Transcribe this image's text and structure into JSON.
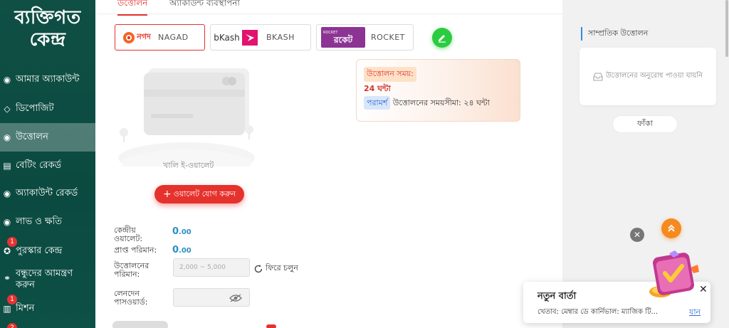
{
  "sidebar": {
    "title_line1": "ব্যক্তিগত",
    "title_line2": "কেন্দ্র",
    "items": [
      {
        "label": "আমার অ্যাকাউন্ট"
      },
      {
        "label": "ডিপোজিট"
      },
      {
        "label": "উত্তোলন"
      },
      {
        "label": "বেটিং রেকর্ড"
      },
      {
        "label": "অ্যাকাউন্ট রেকর্ড"
      },
      {
        "label": "লাভ ও ক্ষতি"
      },
      {
        "label": "পুরস্কার কেন্দ্র",
        "badge": "1"
      },
      {
        "label_line1": "বন্ধুদের আমন্ত্রণ",
        "label_line2": "করুন"
      },
      {
        "label": "মিশন",
        "badge": "1"
      }
    ],
    "next_badge": "2"
  },
  "tabs": [
    {
      "label": "উত্তোলন",
      "active": true
    },
    {
      "label": "অ্যাকাউন্ট ব্যবস্থাপনা",
      "active": false
    }
  ],
  "payment_methods": [
    {
      "logo_text": "নগদ",
      "name": "NAGAD",
      "selected": true
    },
    {
      "logo_text": "bKash",
      "name": "BKASH",
      "selected": false
    },
    {
      "logo_text": "রকেট",
      "logo_small": "ROCKET",
      "name": "ROCKET",
      "selected": false
    }
  ],
  "wallet": {
    "empty_label": "খালি ই-ওয়ালেট",
    "add_button": "ওয়ালেট যোগ করুন"
  },
  "info": {
    "time_tag": "উত্তোলন সময়:",
    "time_value": "24 ঘন্টা",
    "advice_tag": "পরামর্শ",
    "advice_text": "উত্তোলনের সময়সীমা: ২৪ ঘন্টা"
  },
  "form": {
    "central_wallet_label_1": "কেন্দ্রীয়",
    "central_wallet_label_2": "ওয়ালেট:",
    "central_wallet_value": "0",
    "central_wallet_decimals": ".00",
    "received_label": "প্রাপ্ত পরিমান:",
    "received_value": "0",
    "received_decimals": ".00",
    "withdraw_amount_label_1": "উত্তোলনের",
    "withdraw_amount_label_2": "পরিমান:",
    "withdraw_amount_placeholder": "2,000 ~ 5,000",
    "refresh_label": "ফিরে চলুন",
    "password_label_1": "লেনদেন",
    "password_label_2": "পাসওয়ার্ড:"
  },
  "recent": {
    "title": "সাম্প্রতিক উত্তোলন",
    "empty_text": "উত্তোলনের অনুরোধ পাওয়া যায়নি",
    "empty_button": "ফাঁকা"
  },
  "news": {
    "title": "নতুন বার্তা",
    "text": "খেতাব: মেম্বার ডে কার্নিভাল: ম্যাজিক টি...",
    "link": "যান"
  },
  "colors": {
    "accent_red": "#e5322d",
    "sidebar_green": "#0f4f44",
    "value_blue": "#2b8fc6",
    "edit_green": "#2bcc3f",
    "up_orange": "#f58a1f"
  }
}
